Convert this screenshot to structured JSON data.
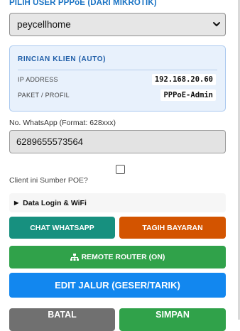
{
  "form": {
    "user_label": "PILIH USER PPPoE (DARI MIKROTIK)",
    "selected_user": "peycellhome"
  },
  "client_card": {
    "title": "RINCIAN KLIEN (AUTO)",
    "rows": [
      {
        "label": "IP ADDRESS",
        "value": "192.168.20.60"
      },
      {
        "label": "PAKET / PROFIL",
        "value": "PPPoE-Admin"
      }
    ]
  },
  "whatsapp": {
    "label": "No. WhatsApp (Format: 628xxx)",
    "value": "6289655573564"
  },
  "poe": {
    "label": "Client ini Sumber POE?",
    "checked": false
  },
  "details": {
    "summary": "Data Login & WiFi"
  },
  "buttons": {
    "chat_whatsapp": "CHAT WHATSAPP",
    "tagih_bayaran": "TAGIH BAYARAN",
    "remote_router": "REMOTE ROUTER (ON)",
    "edit_jalur": "EDIT JALUR (GESER/TARIK)",
    "batal": "BATAL",
    "simpan": "SIMPAN"
  },
  "colors": {
    "accent_blue": "#1a73c4",
    "whatsapp_teal": "#17907f",
    "bill_orange": "#d35400",
    "green": "#30a24a",
    "edit_blue": "#1287ef",
    "cancel_gray": "#707070",
    "card_bg": "#e8f1fc"
  },
  "icons": {
    "remote_router": "network-icon",
    "details_toggle": "triangle-right-icon",
    "select_toggle": "chevron-down-icon"
  }
}
